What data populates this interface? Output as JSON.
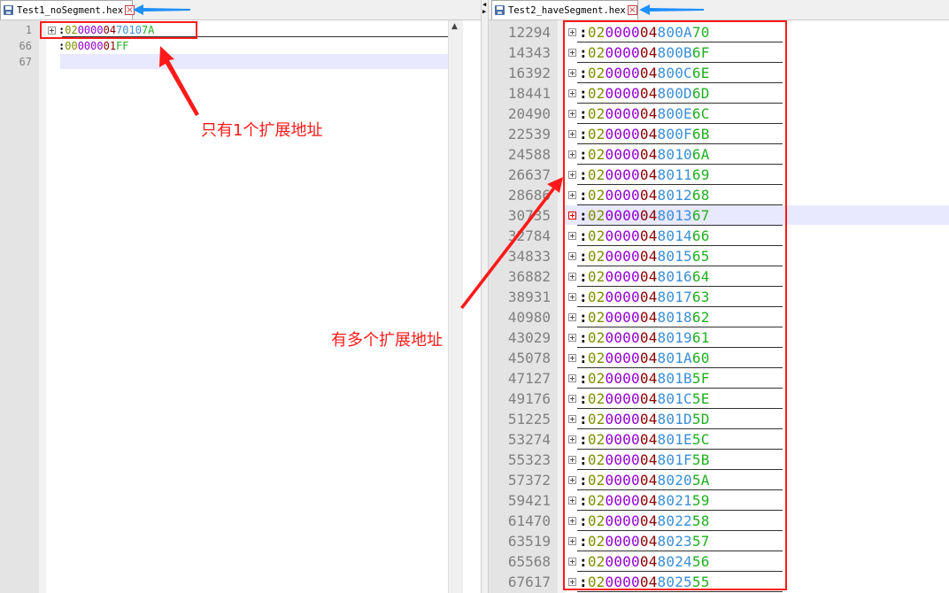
{
  "left": {
    "tab_title": "Test1_noSegment.hex",
    "lines": [
      {
        "num": "1",
        "colon": ":",
        "len": "02",
        "addr": "0000",
        "type": "04",
        "data": "7010",
        "chk": "7A",
        "fold": true
      },
      {
        "num": "66",
        "colon": ":",
        "len": "00",
        "addr": "0000",
        "type": "01",
        "data": "",
        "chk": "FF",
        "fold": false
      },
      {
        "num": "67",
        "colon": "",
        "len": "",
        "addr": "",
        "type": "",
        "data": "",
        "chk": "",
        "fold": false
      }
    ]
  },
  "right": {
    "tab_title": "Test2_haveSegment.hex",
    "active_line": 9,
    "lines": [
      {
        "num": "12294",
        "colon": ":",
        "len": "02",
        "addr": "0000",
        "type": "04",
        "data": "800A",
        "chk": "70"
      },
      {
        "num": "14343",
        "colon": ":",
        "len": "02",
        "addr": "0000",
        "type": "04",
        "data": "800B",
        "chk": "6F"
      },
      {
        "num": "16392",
        "colon": ":",
        "len": "02",
        "addr": "0000",
        "type": "04",
        "data": "800C",
        "chk": "6E"
      },
      {
        "num": "18441",
        "colon": ":",
        "len": "02",
        "addr": "0000",
        "type": "04",
        "data": "800D",
        "chk": "6D"
      },
      {
        "num": "20490",
        "colon": ":",
        "len": "02",
        "addr": "0000",
        "type": "04",
        "data": "800E",
        "chk": "6C"
      },
      {
        "num": "22539",
        "colon": ":",
        "len": "02",
        "addr": "0000",
        "type": "04",
        "data": "800F",
        "chk": "6B"
      },
      {
        "num": "24588",
        "colon": ":",
        "len": "02",
        "addr": "0000",
        "type": "04",
        "data": "8010",
        "chk": "6A"
      },
      {
        "num": "26637",
        "colon": ":",
        "len": "02",
        "addr": "0000",
        "type": "04",
        "data": "8011",
        "chk": "69"
      },
      {
        "num": "28686",
        "colon": ":",
        "len": "02",
        "addr": "0000",
        "type": "04",
        "data": "8012",
        "chk": "68"
      },
      {
        "num": "30735",
        "colon": ":",
        "len": "02",
        "addr": "0000",
        "type": "04",
        "data": "8013",
        "chk": "67"
      },
      {
        "num": "32784",
        "colon": ":",
        "len": "02",
        "addr": "0000",
        "type": "04",
        "data": "8014",
        "chk": "66"
      },
      {
        "num": "34833",
        "colon": ":",
        "len": "02",
        "addr": "0000",
        "type": "04",
        "data": "8015",
        "chk": "65"
      },
      {
        "num": "36882",
        "colon": ":",
        "len": "02",
        "addr": "0000",
        "type": "04",
        "data": "8016",
        "chk": "64"
      },
      {
        "num": "38931",
        "colon": ":",
        "len": "02",
        "addr": "0000",
        "type": "04",
        "data": "8017",
        "chk": "63"
      },
      {
        "num": "40980",
        "colon": ":",
        "len": "02",
        "addr": "0000",
        "type": "04",
        "data": "8018",
        "chk": "62"
      },
      {
        "num": "43029",
        "colon": ":",
        "len": "02",
        "addr": "0000",
        "type": "04",
        "data": "8019",
        "chk": "61"
      },
      {
        "num": "45078",
        "colon": ":",
        "len": "02",
        "addr": "0000",
        "type": "04",
        "data": "801A",
        "chk": "60"
      },
      {
        "num": "47127",
        "colon": ":",
        "len": "02",
        "addr": "0000",
        "type": "04",
        "data": "801B",
        "chk": "5F"
      },
      {
        "num": "49176",
        "colon": ":",
        "len": "02",
        "addr": "0000",
        "type": "04",
        "data": "801C",
        "chk": "5E"
      },
      {
        "num": "51225",
        "colon": ":",
        "len": "02",
        "addr": "0000",
        "type": "04",
        "data": "801D",
        "chk": "5D"
      },
      {
        "num": "53274",
        "colon": ":",
        "len": "02",
        "addr": "0000",
        "type": "04",
        "data": "801E",
        "chk": "5C"
      },
      {
        "num": "55323",
        "colon": ":",
        "len": "02",
        "addr": "0000",
        "type": "04",
        "data": "801F",
        "chk": "5B"
      },
      {
        "num": "57372",
        "colon": ":",
        "len": "02",
        "addr": "0000",
        "type": "04",
        "data": "8020",
        "chk": "5A"
      },
      {
        "num": "59421",
        "colon": ":",
        "len": "02",
        "addr": "0000",
        "type": "04",
        "data": "8021",
        "chk": "59"
      },
      {
        "num": "61470",
        "colon": ":",
        "len": "02",
        "addr": "0000",
        "type": "04",
        "data": "8022",
        "chk": "58"
      },
      {
        "num": "63519",
        "colon": ":",
        "len": "02",
        "addr": "0000",
        "type": "04",
        "data": "8023",
        "chk": "57"
      },
      {
        "num": "65568",
        "colon": ":",
        "len": "02",
        "addr": "0000",
        "type": "04",
        "data": "8024",
        "chk": "56"
      },
      {
        "num": "67617",
        "colon": ":",
        "len": "02",
        "addr": "0000",
        "type": "04",
        "data": "8025",
        "chk": "55"
      }
    ]
  },
  "annotations": {
    "single": "只有1个扩展地址",
    "multiple": "有多个扩展地址"
  },
  "colors": {
    "annotation_red": "#ff1a1a",
    "tab_arrow_blue": "#1e90ff",
    "record_length": "#7f8f00",
    "address": "#9400d3",
    "record_type": "#8b0000",
    "data": "#3b8fd8",
    "checksum": "#1fb01f"
  }
}
